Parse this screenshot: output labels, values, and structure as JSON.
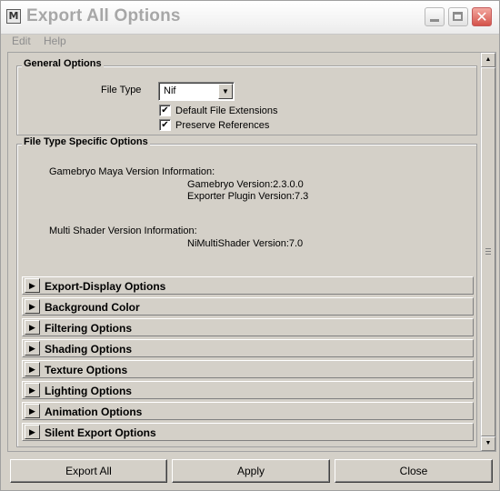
{
  "window": {
    "title": "Export All Options",
    "app_icon_glyph": "M"
  },
  "menu": [
    "Edit",
    "Help"
  ],
  "general": {
    "title": "General Options",
    "file_type_label": "File Type",
    "file_type_value": "Nif",
    "default_ext_label": "Default File Extensions",
    "default_ext_checked": true,
    "preserve_refs_label": "Preserve References",
    "preserve_refs_checked": true,
    "check_glyph": "✔"
  },
  "specific": {
    "title": "File Type Specific Options",
    "gamebryo_header": "Gamebryo Maya Version Information:",
    "gamebryo_version": "Gamebryo Version:2.3.0.0",
    "exporter_version": "Exporter Plugin Version:7.3",
    "multishader_header": "Multi Shader Version Information:",
    "nimultishader_version": "NiMultiShader Version:7.0"
  },
  "sections": [
    "Export-Display Options",
    "Background Color",
    "Filtering Options",
    "Shading Options",
    "Texture Options",
    "Lighting Options",
    "Animation Options",
    "Silent Export Options"
  ],
  "buttons": {
    "export_all": "Export All",
    "apply": "Apply",
    "close": "Close"
  },
  "glyphs": {
    "expand": "▶",
    "up": "▲",
    "down": "▼",
    "close": "✕"
  }
}
